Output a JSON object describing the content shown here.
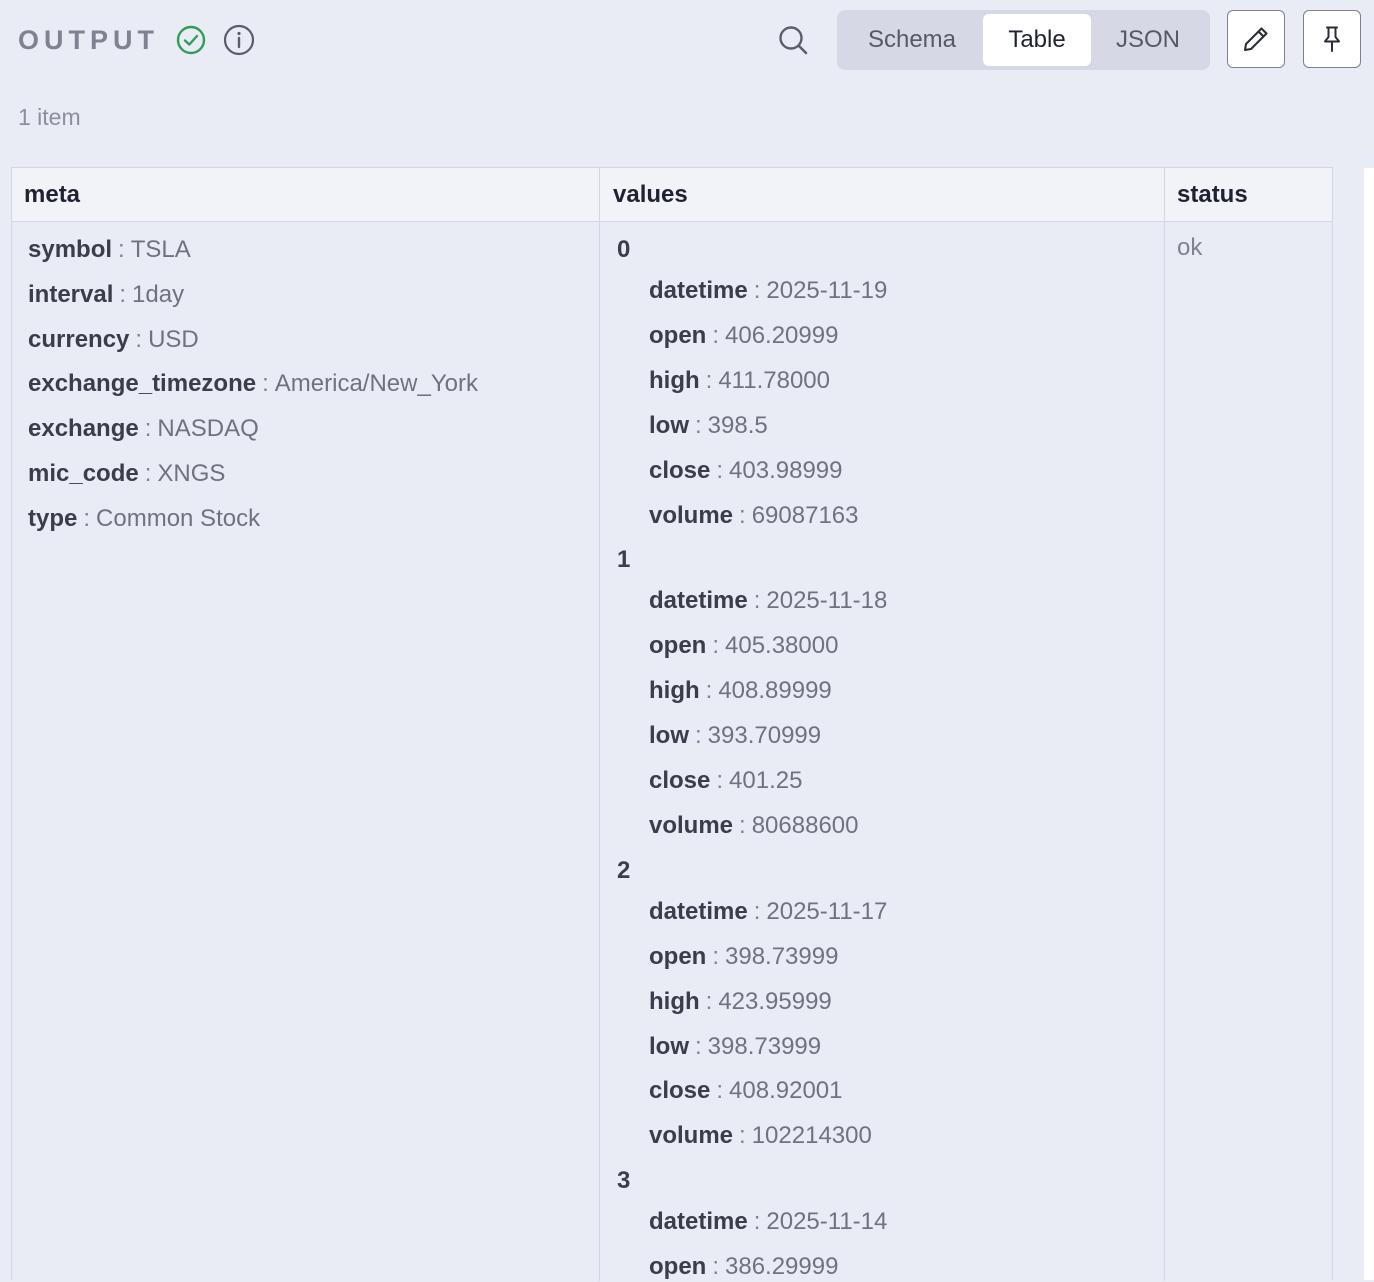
{
  "header": {
    "title": "OUTPUT",
    "tabs": [
      {
        "label": "Schema",
        "active": false
      },
      {
        "label": "Table",
        "active": true
      },
      {
        "label": "JSON",
        "active": false
      }
    ],
    "status_color": "#2e9e57"
  },
  "summary": {
    "item_count": "1 item"
  },
  "table": {
    "columns": [
      "meta",
      "values",
      "status"
    ],
    "meta": [
      {
        "key": "symbol",
        "value": "TSLA"
      },
      {
        "key": "interval",
        "value": "1day"
      },
      {
        "key": "currency",
        "value": "USD"
      },
      {
        "key": "exchange_timezone",
        "value": "America/New_York"
      },
      {
        "key": "exchange",
        "value": "NASDAQ"
      },
      {
        "key": "mic_code",
        "value": "XNGS"
      },
      {
        "key": "type",
        "value": "Common Stock"
      }
    ],
    "values": [
      {
        "index": "0",
        "fields": [
          {
            "key": "datetime",
            "value": "2025-11-19"
          },
          {
            "key": "open",
            "value": "406.20999"
          },
          {
            "key": "high",
            "value": "411.78000"
          },
          {
            "key": "low",
            "value": "398.5"
          },
          {
            "key": "close",
            "value": "403.98999"
          },
          {
            "key": "volume",
            "value": "69087163"
          }
        ]
      },
      {
        "index": "1",
        "fields": [
          {
            "key": "datetime",
            "value": "2025-11-18"
          },
          {
            "key": "open",
            "value": "405.38000"
          },
          {
            "key": "high",
            "value": "408.89999"
          },
          {
            "key": "low",
            "value": "393.70999"
          },
          {
            "key": "close",
            "value": "401.25"
          },
          {
            "key": "volume",
            "value": "80688600"
          }
        ]
      },
      {
        "index": "2",
        "fields": [
          {
            "key": "datetime",
            "value": "2025-11-17"
          },
          {
            "key": "open",
            "value": "398.73999"
          },
          {
            "key": "high",
            "value": "423.95999"
          },
          {
            "key": "low",
            "value": "398.73999"
          },
          {
            "key": "close",
            "value": "408.92001"
          },
          {
            "key": "volume",
            "value": "102214300"
          }
        ]
      },
      {
        "index": "3",
        "fields": [
          {
            "key": "datetime",
            "value": "2025-11-14"
          },
          {
            "key": "open",
            "value": "386.29999"
          }
        ]
      }
    ],
    "status": "ok"
  }
}
